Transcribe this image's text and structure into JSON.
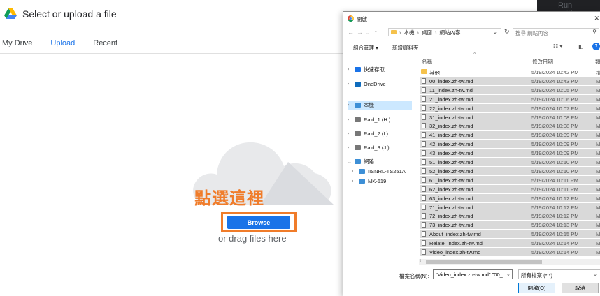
{
  "picker": {
    "title": "Select or upload a file",
    "tabs": [
      "My Drive",
      "Upload",
      "Recent"
    ],
    "active_tab": "Upload",
    "annotation": "點選這裡",
    "browse_label": "Browse",
    "drag_text": "or drag files here",
    "run_settings": "Run settings",
    "accent_color": "#1a73e8",
    "annotation_color": "#f07c2a"
  },
  "dialog": {
    "title": "開啟",
    "address": [
      "本機",
      "桌面",
      "網站內容"
    ],
    "search_placeholder": "搜尋 網站內容",
    "toolbar": {
      "organize": "組合管理 ▾",
      "new_folder": "新增資料夾"
    },
    "columns": {
      "name": "名稱",
      "date": "修改日期",
      "type": "類"
    },
    "nav": [
      {
        "label": "快速存取",
        "icon": "star-icon",
        "chev": "›",
        "sub": false
      },
      {
        "label": "OneDrive",
        "icon": "cloud-icon",
        "chev": "›",
        "sub": false
      },
      {
        "label": "本機",
        "icon": "computer-icon",
        "chev": "›",
        "sub": false,
        "selected": true
      },
      {
        "label": "Raid_1 (H:)",
        "icon": "drive-icon",
        "chev": "›",
        "sub": false
      },
      {
        "label": "Raid_2 (I:)",
        "icon": "drive-icon",
        "chev": "›",
        "sub": false
      },
      {
        "label": "Raid_3 (J:)",
        "icon": "drive-icon",
        "chev": "›",
        "sub": false
      },
      {
        "label": "網路",
        "icon": "network-icon",
        "chev": "⌄",
        "sub": false
      },
      {
        "label": "IISNRL-TS251A",
        "icon": "computer-icon",
        "chev": "›",
        "sub": true
      },
      {
        "label": "MK-619",
        "icon": "computer-icon",
        "chev": "›",
        "sub": true
      }
    ],
    "files": [
      {
        "name": "其他",
        "date": "5/19/2024 10:42 PM",
        "type": "檔",
        "folder": true,
        "selected": false
      },
      {
        "name": "00_index.zh-tw.md",
        "date": "5/19/2024 10:43 PM",
        "type": "M",
        "selected": true
      },
      {
        "name": "11_index.zh-tw.md",
        "date": "5/19/2024 10:05 PM",
        "type": "M",
        "selected": true
      },
      {
        "name": "21_index.zh-tw.md",
        "date": "5/19/2024 10:06 PM",
        "type": "M",
        "selected": true
      },
      {
        "name": "22_index.zh-tw.md",
        "date": "5/19/2024 10:07 PM",
        "type": "M",
        "selected": true
      },
      {
        "name": "31_index.zh-tw.md",
        "date": "5/19/2024 10:08 PM",
        "type": "M",
        "selected": true
      },
      {
        "name": "32_index.zh-tw.md",
        "date": "5/19/2024 10:08 PM",
        "type": "M",
        "selected": true
      },
      {
        "name": "41_index.zh-tw.md",
        "date": "5/19/2024 10:09 PM",
        "type": "M",
        "selected": true
      },
      {
        "name": "42_index.zh-tw.md",
        "date": "5/19/2024 10:09 PM",
        "type": "M",
        "selected": true
      },
      {
        "name": "43_index.zh-tw.md",
        "date": "5/19/2024 10:09 PM",
        "type": "M",
        "selected": true
      },
      {
        "name": "51_index.zh-tw.md",
        "date": "5/19/2024 10:10 PM",
        "type": "M",
        "selected": true
      },
      {
        "name": "52_index.zh-tw.md",
        "date": "5/19/2024 10:10 PM",
        "type": "M",
        "selected": true
      },
      {
        "name": "61_index.zh-tw.md",
        "date": "5/19/2024 10:11 PM",
        "type": "M",
        "selected": true
      },
      {
        "name": "62_index.zh-tw.md",
        "date": "5/19/2024 10:11 PM",
        "type": "M",
        "selected": true
      },
      {
        "name": "63_index.zh-tw.md",
        "date": "5/19/2024 10:12 PM",
        "type": "M",
        "selected": true
      },
      {
        "name": "71_index.zh-tw.md",
        "date": "5/19/2024 10:12 PM",
        "type": "M",
        "selected": true
      },
      {
        "name": "72_index.zh-tw.md",
        "date": "5/19/2024 10:12 PM",
        "type": "M",
        "selected": true
      },
      {
        "name": "73_index.zh-tw.md",
        "date": "5/19/2024 10:13 PM",
        "type": "M",
        "selected": true
      },
      {
        "name": "About_index.zh-tw.md",
        "date": "5/19/2024 10:15 PM",
        "type": "M",
        "selected": true
      },
      {
        "name": "Relate_index.zh-tw.md",
        "date": "5/19/2024 10:14 PM",
        "type": "M",
        "selected": true
      },
      {
        "name": "Video_index.zh-tw.md",
        "date": "5/19/2024 10:14 PM",
        "type": "M",
        "selected": true
      }
    ],
    "filename_label": "檔案名稱(N):",
    "filename_value": "\"Video_index.zh-tw.md\" \"00_",
    "filter_value": "所有檔案 (*.*)",
    "open_label": "開啟(O)",
    "cancel_label": "取消"
  }
}
